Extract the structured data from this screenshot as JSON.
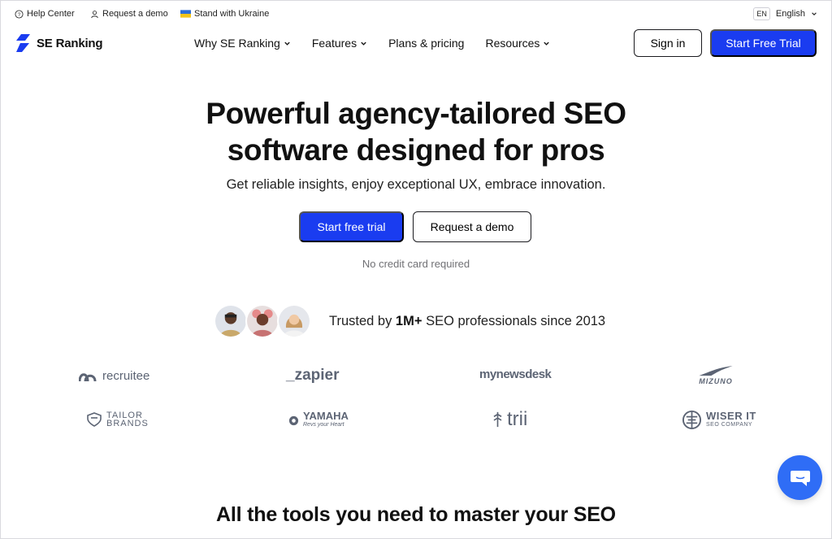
{
  "topbar": {
    "help_center": "Help Center",
    "request_demo": "Request a demo",
    "ukraine": "Stand with Ukraine",
    "lang_code": "EN",
    "lang_label": "English"
  },
  "brand": {
    "name": "SE Ranking",
    "color": "#1a3cf0"
  },
  "nav": {
    "items": [
      {
        "label": "Why SE Ranking",
        "has_dropdown": true
      },
      {
        "label": "Features",
        "has_dropdown": true
      },
      {
        "label": "Plans & pricing",
        "has_dropdown": false
      },
      {
        "label": "Resources",
        "has_dropdown": true
      }
    ],
    "sign_in": "Sign in",
    "start_trial": "Start Free Trial"
  },
  "hero": {
    "title_line1": "Powerful agency-tailored SEO",
    "title_line2": "software designed for pros",
    "subtitle": "Get reliable insights, enjoy exceptional UX, embrace innovation.",
    "cta_primary": "Start free trial",
    "cta_secondary": "Request a demo",
    "note": "No credit card required"
  },
  "trusted": {
    "prefix": "Trusted by ",
    "count": "1M+",
    "suffix": " SEO professionals since 2013"
  },
  "client_logos": {
    "recruitee": "recruitee",
    "zapier": "_zapier",
    "mynewsdesk": "mynewsdesk",
    "mizuno": "MIZUNO",
    "tailor_line1": "TAILOR",
    "tailor_line2": "BRANDS",
    "yamaha": "YAMAHA",
    "yamaha_tag": "Revs your Heart",
    "trii": "trii",
    "wiser_line1": "WISER IT",
    "wiser_line2": "SEO COMPANY"
  },
  "section": {
    "title": "All the tools you need to master your SEO"
  },
  "colors": {
    "accent": "#1a3cf0",
    "chat": "#2f6df6",
    "logo_gray": "#5c6474"
  }
}
